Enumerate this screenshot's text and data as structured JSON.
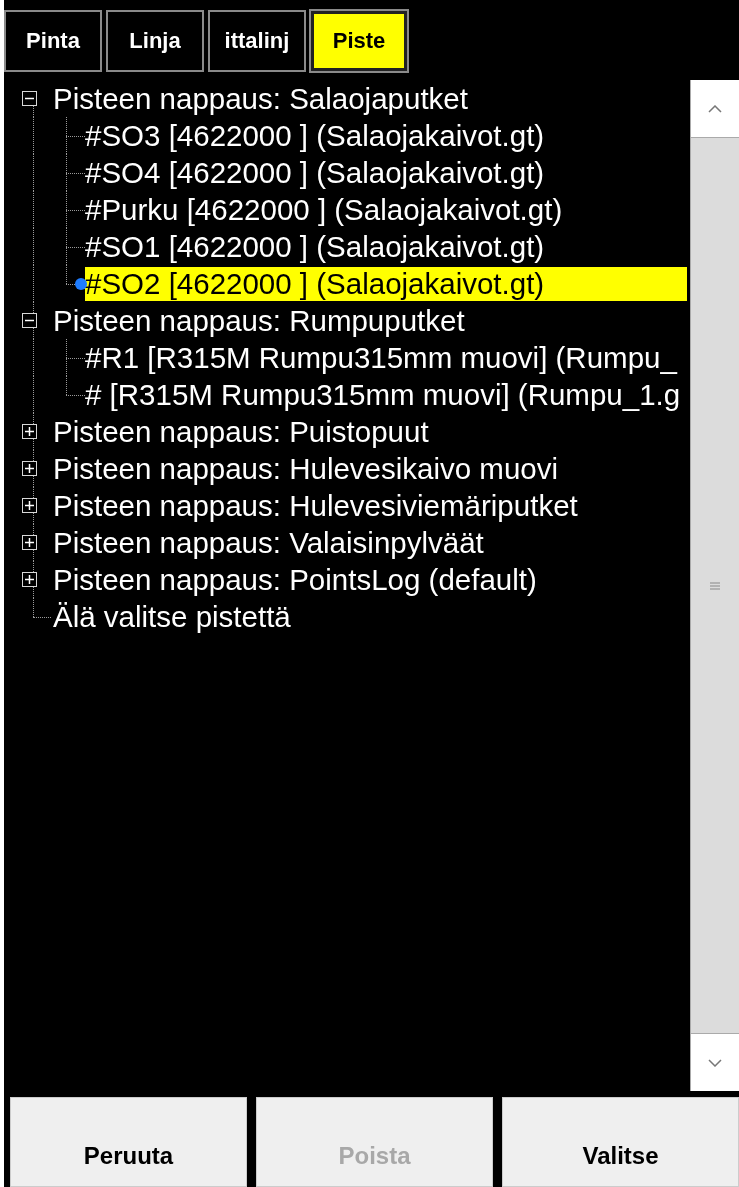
{
  "tabs": [
    {
      "label": "Pinta",
      "selected": false
    },
    {
      "label": "Linja",
      "selected": false
    },
    {
      "label": "ittalinj",
      "selected": false
    },
    {
      "label": "Piste",
      "selected": true
    }
  ],
  "tree": [
    {
      "label": "Pisteen nappaus: Salaojaputket",
      "expanded": true,
      "children": [
        {
          "label": "#SO3 [4622000 ] (Salaojakaivot.gt)",
          "selected": false
        },
        {
          "label": "#SO4 [4622000 ] (Salaojakaivot.gt)",
          "selected": false
        },
        {
          "label": "#Purku [4622000 ] (Salaojakaivot.gt)",
          "selected": false
        },
        {
          "label": "#SO1 [4622000 ] (Salaojakaivot.gt)",
          "selected": false
        },
        {
          "label": "#SO2 [4622000 ] (Salaojakaivot.gt)",
          "selected": true
        }
      ]
    },
    {
      "label": "Pisteen nappaus: Rumpuputket",
      "expanded": true,
      "children": [
        {
          "label": "#R1 [R315M Rumpu315mm muovi] (Rumpu_",
          "selected": false
        },
        {
          "label": "# [R315M Rumpu315mm muovi] (Rumpu_1.g",
          "selected": false
        }
      ]
    },
    {
      "label": "Pisteen nappaus: Puistopuut",
      "expanded": false
    },
    {
      "label": "Pisteen nappaus: Hulevesikaivo muovi",
      "expanded": false
    },
    {
      "label": "Pisteen nappaus: Hulevesiviemäriputket",
      "expanded": false
    },
    {
      "label": "Pisteen nappaus: Valaisinpylväät",
      "expanded": false
    },
    {
      "label": "Pisteen nappaus: PointsLog (default)",
      "expanded": false
    },
    {
      "label": "Älä valitse pistettä"
    }
  ],
  "buttons": [
    {
      "label": "Peruuta",
      "disabled": false
    },
    {
      "label": "Poista",
      "disabled": true
    },
    {
      "label": "Valitse",
      "disabled": false
    }
  ]
}
